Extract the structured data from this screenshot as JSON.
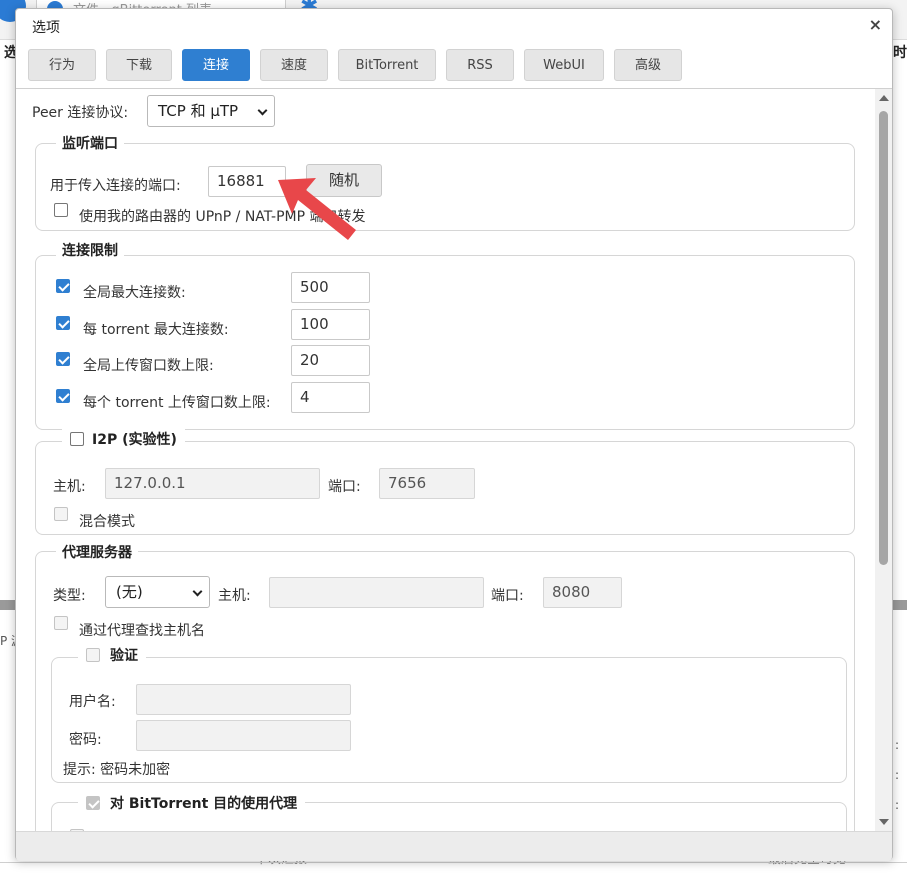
{
  "background": {
    "tab_text": "文件 · qBittorrent 列表",
    "left_header_char": "选",
    "right_header_char": "时",
    "left_small_text": "P 源",
    "right_colon": ":",
    "bottom_left_text": "下次汇报",
    "bottom_right_text": "最后完全可见"
  },
  "dialog": {
    "title": "选项",
    "close_label": "×",
    "tabs": [
      "行为",
      "下载",
      "连接",
      "速度",
      "BitTorrent",
      "RSS",
      "WebUI",
      "高级"
    ],
    "active_tab": "连接"
  },
  "peer": {
    "label": "Peer 连接协议:",
    "protocol": "TCP 和 μTP"
  },
  "listen_port": {
    "legend": "监听端口",
    "port_label": "用于传入连接的端口:",
    "port_value": "16881",
    "random_button": "随机",
    "upnp_label": "使用我的路由器的 UPnP / NAT-PMP 端口转发",
    "upnp_checked": false
  },
  "connection_limits": {
    "legend": "连接限制",
    "items": [
      {
        "label": "全局最大连接数:",
        "value": "500",
        "checked": true
      },
      {
        "label": "每 torrent 最大连接数:",
        "value": "100",
        "checked": true
      },
      {
        "label": "全局上传窗口数上限:",
        "value": "20",
        "checked": true
      },
      {
        "label": "每个 torrent 上传窗口数上限:",
        "value": "4",
        "checked": true
      }
    ]
  },
  "i2p": {
    "legend": "I2P (实验性)",
    "enabled": false,
    "host_label": "主机:",
    "host_value": "127.0.0.1",
    "port_label": "端口:",
    "port_value": "7656",
    "mixed_label": "混合模式"
  },
  "proxy": {
    "legend": "代理服务器",
    "type_label": "类型:",
    "type_value": "(无)",
    "host_label": "主机:",
    "host_value": "",
    "port_label": "端口:",
    "port_value": "8080",
    "lookup_label": "通过代理查找主机名",
    "auth": {
      "legend": "验证",
      "user_label": "用户名:",
      "pass_label": "密码:",
      "hint": "提示: 密码未加密"
    },
    "bittorrent_legend": "对 BitTorrent 目的使用代理"
  },
  "colors": {
    "accent": "#2f7fd1",
    "arrow": "#e8474a"
  },
  "icons": [
    "close-icon",
    "chevron-down-icon",
    "arrow-annotation-icon",
    "checkbox-icon"
  ]
}
